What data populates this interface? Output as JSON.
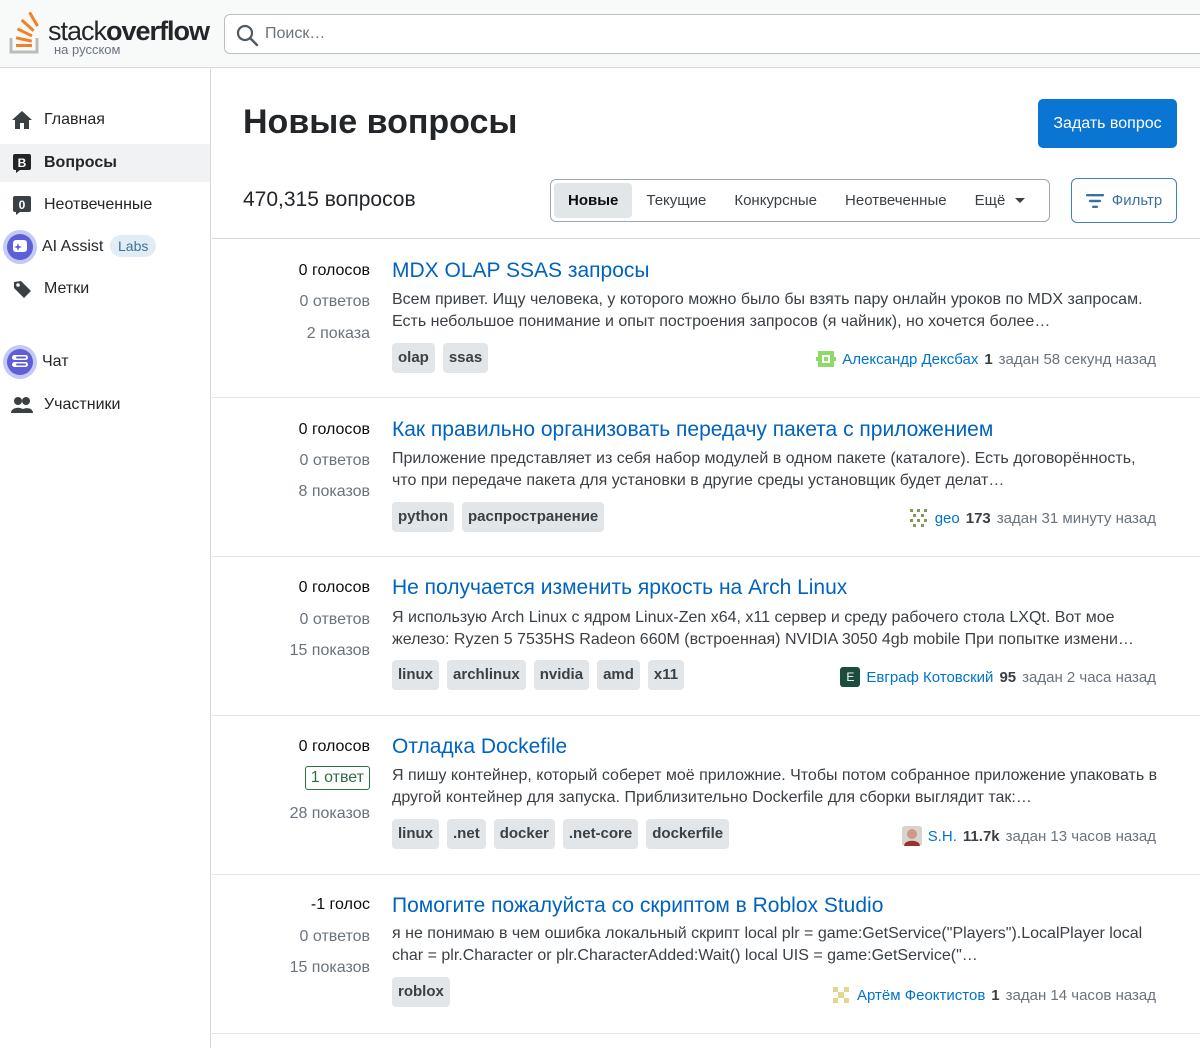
{
  "header": {
    "logo_word_light": "stack",
    "logo_word_bold": "overflow",
    "logo_sub": "на русском",
    "search_placeholder": "Поиск…"
  },
  "sidebar": {
    "items": [
      {
        "label": "Главная",
        "icon": "home-icon"
      },
      {
        "label": "Вопросы",
        "icon": "questions-icon"
      },
      {
        "label": "Неотвеченные",
        "icon": "unanswered-icon"
      },
      {
        "label": "AI Assist",
        "icon": "ai-assist-icon",
        "badge": "Labs"
      },
      {
        "label": "Метки",
        "icon": "tag-icon"
      },
      {
        "label": "Чат",
        "icon": "chat-icon"
      },
      {
        "label": "Участники",
        "icon": "users-icon"
      }
    ]
  },
  "main": {
    "title": "Новые вопросы",
    "ask_button": "Задать вопрос",
    "count": "470,315 вопросов",
    "tabs": [
      "Новые",
      "Текущие",
      "Конкурсные",
      "Неотвеченные",
      "Ещё"
    ],
    "filter_button": "Фильтр"
  },
  "colors": {
    "accent": "#0a75d3",
    "link": "#0063bf",
    "answered": "#2f6f44"
  },
  "questions": [
    {
      "votes": "0 голосов",
      "answers": "0 ответов",
      "views": "2 показа",
      "title": "MDX OLAP SSAS запросы",
      "excerpt": "Всем привет. Ищу человека, у которого можно было бы взять пару онлайн уроков по MDX запросам. Есть небольшое понимание и опыт построения запросов (я чайник), но хочется более…",
      "tags": [
        "olap",
        "ssas"
      ],
      "user": "Александр Дексбах",
      "rep": "1",
      "time": "задан 58 секунд назад",
      "answered": false
    },
    {
      "votes": "0 голосов",
      "answers": "0 ответов",
      "views": "8 показов",
      "title": "Как правильно организовать передачу пакета с приложением",
      "excerpt": "Приложение представляет из себя набор модулей в одном пакете (каталоге). Есть договорённость, что при передаче пакета для установки в другие среды установщик будет делат…",
      "tags": [
        "python",
        "распространение"
      ],
      "user": "geo",
      "rep": "173",
      "time": "задан 31 минуту назад",
      "answered": false
    },
    {
      "votes": "0 голосов",
      "answers": "0 ответов",
      "views": "15 показов",
      "title": "Не получается изменить яркость на Arch Linux",
      "excerpt": "Я использую Arch Linux с ядром Linux-Zen x64, x11 сервер и среду рабочего стола LXQt. Вот мое железо: Ryzen 5 7535HS Radeon 660M (встроенная) NVIDIA 3050 4gb mobile При попытке измени…",
      "tags": [
        "linux",
        "archlinux",
        "nvidia",
        "amd",
        "x11"
      ],
      "user": "Евграф Котовский",
      "rep": "95",
      "time": "задан 2 часа назад",
      "answered": false,
      "avatar_letter": "E"
    },
    {
      "votes": "0 голосов",
      "answers": "1 ответ",
      "views": "28 показов",
      "title": "Отладка Dockefile",
      "excerpt": "Я пишу контейнер, который соберет моё приложние. Чтобы потом собранное приложение упаковать в другой контейнер для запуска. Приблизительно Dockerfile для сборки выглядит так:…",
      "tags": [
        "linux",
        ".net",
        "docker",
        ".net-core",
        "dockerfile"
      ],
      "user": "S.H.",
      "rep": "11.7k",
      "time": "задан 13 часов назад",
      "answered": true
    },
    {
      "votes": "-1 голос",
      "answers": "0 ответов",
      "views": "15 показов",
      "title": "Помогите пожалуйста со скриптом в Roblox Studio",
      "excerpt": "я не понимаю в чем ошибка локальный скрипт local plr = game:GetService(\"Players\").LocalPlayer local char = plr.Character or plr.CharacterAdded:Wait() local UIS = game:GetService(\"…",
      "tags": [
        "roblox"
      ],
      "user": "Артём Феоктистов",
      "rep": "1",
      "time": "задан 14 часов назад",
      "answered": false
    }
  ]
}
